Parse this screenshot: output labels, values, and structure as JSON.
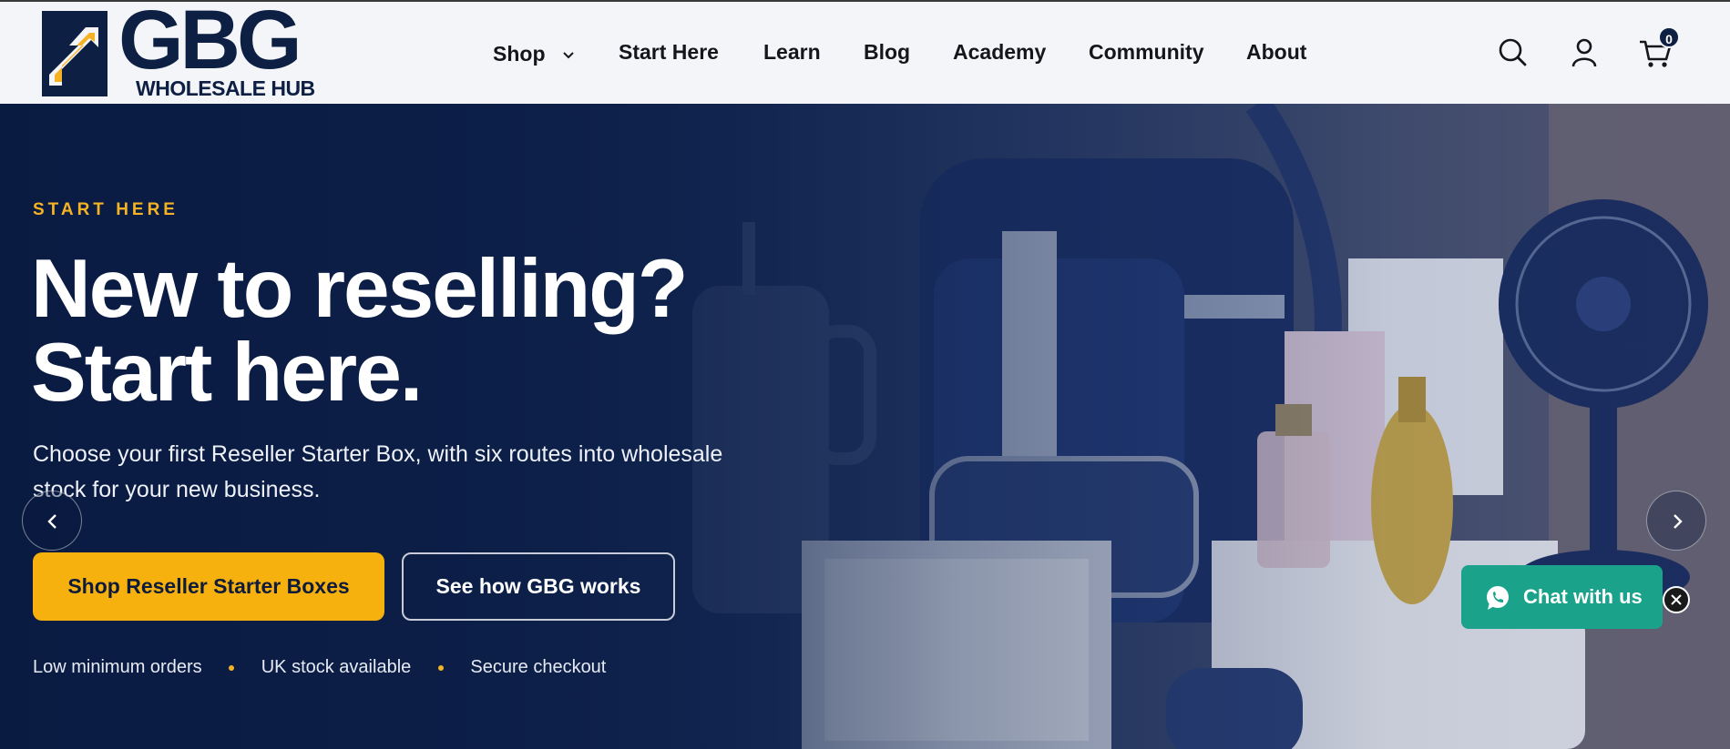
{
  "brand": {
    "logo_word": "GBG",
    "logo_subtitle": "WHOLESALE HUB"
  },
  "nav": {
    "items": [
      {
        "label": "Shop",
        "has_dropdown": true
      },
      {
        "label": "Start Here"
      },
      {
        "label": "Learn"
      },
      {
        "label": "Blog"
      },
      {
        "label": "Academy"
      },
      {
        "label": "Community"
      },
      {
        "label": "About"
      }
    ]
  },
  "header_icons": {
    "search": "search-icon",
    "account": "user-icon",
    "cart": "cart-icon",
    "cart_count": "0"
  },
  "hero": {
    "eyebrow": "START HERE",
    "headline_line1": "New to reselling?",
    "headline_line2": "Start here.",
    "subtext": "Choose your first Reseller Starter Box, with six routes into wholesale stock for your new business.",
    "primary_cta": "Shop Reseller Starter Boxes",
    "secondary_cta": "See how GBG works",
    "features": [
      "Low minimum orders",
      "UK stock available",
      "Secure checkout"
    ],
    "prev_icon": "chevron-left-icon",
    "next_icon": "chevron-right-icon"
  },
  "chat": {
    "label": "Chat with us",
    "icon": "whatsapp-icon",
    "close_icon": "close-icon"
  },
  "colors": {
    "navy": "#0e1f44",
    "accent_yellow": "#f7b10f",
    "chat_green": "#1aa38a",
    "header_bg": "#f3f5f8"
  }
}
